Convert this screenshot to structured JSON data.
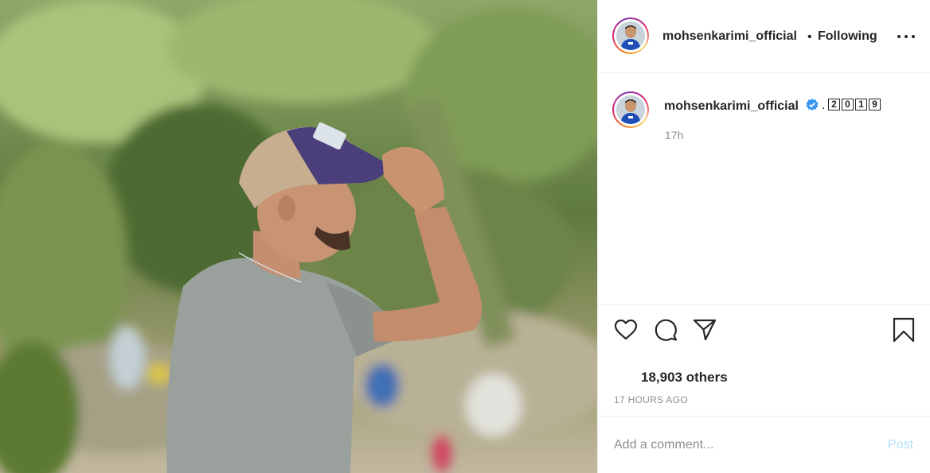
{
  "post": {
    "username": "mohsenkarimi_official",
    "follow_status": "Following",
    "header_separator": "•",
    "caption_separator": ".",
    "caption_boxes": [
      "2",
      "0",
      "1",
      "9"
    ],
    "caption_time": "17h",
    "likes_text": "18,903 others",
    "time_ago": "17 HOURS AGO",
    "comment_placeholder": "Add a comment...",
    "post_label": "Post"
  },
  "icons": {
    "more": "more-options-icon",
    "verified": "verified-badge-icon",
    "like": "heart-icon",
    "comment": "comment-bubble-icon",
    "share": "paper-plane-icon",
    "save": "bookmark-icon"
  },
  "colors": {
    "text": "#262626",
    "muted": "#8e8e8e",
    "verified": "#3897f0",
    "post_disabled": "#b2dffc"
  }
}
